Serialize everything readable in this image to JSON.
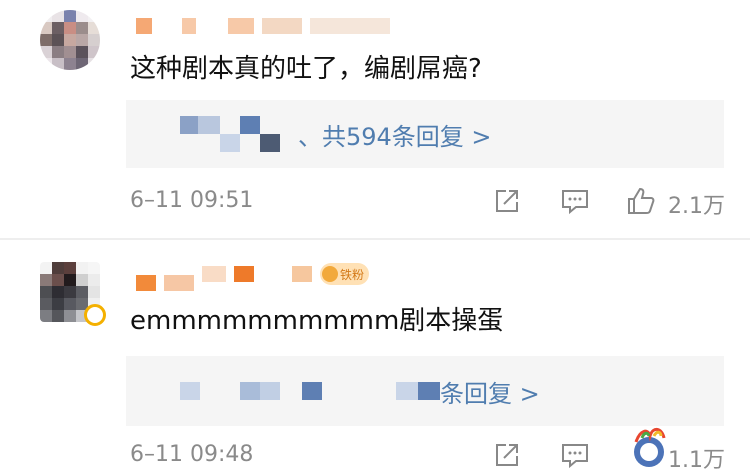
{
  "comments": [
    {
      "text": "这种剧本真的吐了，编剧屌癌?",
      "reply_link": "、共594条回复 >",
      "timestamp": "6–11 09:51",
      "like_count": "2.1万",
      "author_obscured": true
    },
    {
      "text": "emmmmmmmmmm剧本操蛋",
      "fan_badge": "铁粉",
      "reply_link": "条回复 >",
      "timestamp": "6–11 09:48",
      "like_count": "1.1万",
      "author_obscured": true
    }
  ],
  "icons": [
    "share-icon",
    "comment-icon",
    "like-icon",
    "fan-badge-icon",
    "vip-icon",
    "watermark-logo"
  ],
  "colors": {
    "link": "#507daf",
    "meta_text": "#8a8a8a",
    "reply_bg": "#f5f5f5",
    "badge_bg": "#ffe1b5",
    "badge_text": "#d47a19"
  }
}
